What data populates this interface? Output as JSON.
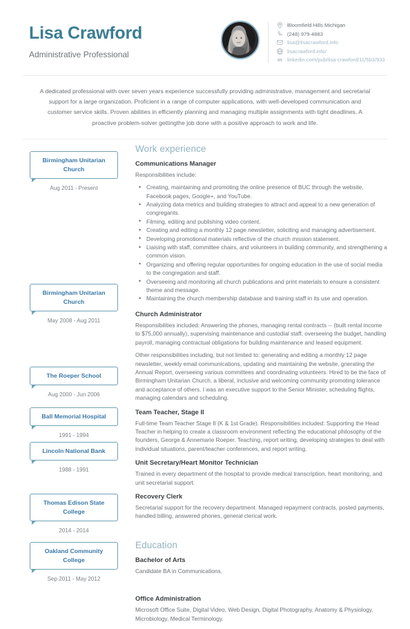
{
  "header": {
    "name": "Lisa Crawford",
    "job_title": "Administrative Professional",
    "avatar_alt": "portrait-photo",
    "contacts": [
      {
        "icon": "location-pin-icon",
        "text": "Bloomfield Hills Michigan",
        "is_link": false
      },
      {
        "icon": "phone-icon",
        "text": "(248) 979-4883",
        "is_link": false
      },
      {
        "icon": "envelope-icon",
        "text": "lisa@lisacrawford.info",
        "is_link": true
      },
      {
        "icon": "globe-icon",
        "text": "lisacrawford.info/",
        "is_link": true
      },
      {
        "icon": "linkedin-icon",
        "text": "linkedin.com/pub/lisa-crawford/11/5b3/933",
        "is_link": true
      }
    ]
  },
  "summary": "A dedicated professional with over seven years experience successfully providing administrative, management and secretarial support for a large organization. Proficient in a range of computer applications, with well-developed communication and customer service skills. Proven abilities in efficiently planning and managing multiple assignments with tight deadlines. A proactive problem-solver gettingthe job done with a positive approach to work and life.",
  "sections": {
    "work_title": "Work experience",
    "education_title": "Education"
  },
  "timeline": [
    {
      "org": "Birmingham Unitarian Church",
      "date": "Aug 2011 - Present"
    },
    {
      "org": "Birmingham Unitarian Church",
      "date": "May 2008 - Aug 2011"
    },
    {
      "org": "The Roeper School",
      "date": "Aug 2000 - Jun 2006"
    },
    {
      "org": "Ball Memorial Hospital",
      "date": "1991 - 1994"
    },
    {
      "org": "Lincoln National Bank",
      "date": "1988 - 1991"
    },
    {
      "org": "Thomas Edison State College",
      "date": "2014 - 2014"
    },
    {
      "org": "Oakland Community College",
      "date": "Sep 2011 - May 2012"
    }
  ],
  "work": [
    {
      "title": "Communications Manager",
      "intro": "Responsibilities include:",
      "bullets": [
        "Creating, maintaining and promoting the online presence of BUC through the website, Facebook pages, Google+, and YouTube.",
        "Analyzing data metrics and building strategies to attract and appeal to a new generation of congregants.",
        "Filming, editing and publishing video content.",
        "Creating and editing a monthly 12 page newsletter, soliciting and managing advertisement.",
        "Developing promotional materials reflective of the church mission statement.",
        "Liaising with staff, committee chairs, and volunteers in building community, and strengthening a common vision.",
        "Organizing and offering regular opportunities for ongoing education in the use of social media to the congregation and staff.",
        "Overseeing and monitoring all church publications and print materials to ensure a consistent theme and message.",
        "Maintaining the church membership database and training staff in its use and operation."
      ]
    },
    {
      "title": "Church Administrator",
      "paragraphs": [
        "Responsibilities included: Answering the phones, managing rental contracts -- (built rental income to $75,000 annually), supervising maintenance and custodial staff, overseeing the budget, handling payroll, managing contractual obligations for building maintenance and leased equipment.",
        "Other responsibilities including, but not limited to: generating and editing a monthly 12 page newsletter, weekly email communications, updating and maintaining the website, gnerating the Annual Report, overseeing various committees and coordinating volunteers. Hired to be the face of Birmingham Unitarian Church, a liberal, inclusive and welcoming community promoting tolerance and acceptance of others. I was an executive support to the Senior Minister, scheduling flights, managing calendars and scheduling."
      ]
    },
    {
      "title": "Team Teacher, Stage II",
      "paragraphs": [
        "Full-time Team Teacher Stage II (K & 1st Grade). Responsibilities included: Supporting the Head Teacher in helping to create a classroom environment reflecting the educational philosophy of the founders, George & Annemarie Roeper. Teaching, report writing, developing strategies to deal with individual situations, parent/teacher conferences, and report writing."
      ]
    },
    {
      "title": "Unit Secretary/Heart Monitor Technician",
      "paragraphs": [
        "Trained in every department of the hospital to provide medical transcription, heart monitoring, and unit secretarial support."
      ]
    },
    {
      "title": "Recovery Clerk",
      "paragraphs": [
        "Secretarial support for the recovery department. Managed repayment contracts, posted payments, handled billing, answered phones, general clerical work."
      ]
    }
  ],
  "education": [
    {
      "title": "Bachelor of Arts",
      "paragraphs": [
        "Candidate BA in Communications."
      ]
    },
    {
      "title": "Office Administration",
      "paragraphs": [
        "Microsoft Office Suite, Digital Video, Web Design, Digital Photography, Anatomy & Physiology, Microbiology, Medical Terminology."
      ]
    }
  ]
}
